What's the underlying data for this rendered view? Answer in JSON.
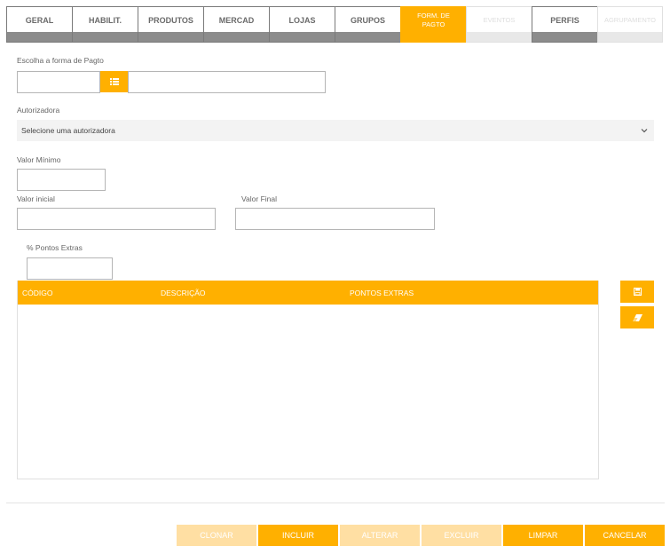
{
  "tabs": [
    {
      "label": "GERAL",
      "state": "normal"
    },
    {
      "label": "HABILIT.",
      "state": "normal"
    },
    {
      "label": "PRODUTOS",
      "state": "normal"
    },
    {
      "label": "MERCAD",
      "state": "normal"
    },
    {
      "label": "LOJAS",
      "state": "normal"
    },
    {
      "label": "GRUPOS",
      "state": "normal"
    },
    {
      "label": "FORM. DE PAGTO",
      "state": "active"
    },
    {
      "label": "EVENTOS",
      "state": "disabled"
    },
    {
      "label": "PERFIS",
      "state": "normal"
    },
    {
      "label": "AGRUPAMENTO",
      "state": "disabled"
    }
  ],
  "form": {
    "payment_label": "Escolha a forma de Pagto",
    "payment_code_value": "",
    "payment_desc_value": "",
    "authorizer_label": "Autorizadora",
    "authorizer_selected": "Selecione uma autorizadora",
    "min_value_label": "Valor Mínimo",
    "initial_value_label": "Valor inicial",
    "final_value_label": "Valor Final",
    "extra_points_label": "% Pontos Extras"
  },
  "grid": {
    "columns": [
      "CÓDIGO",
      "DESCRIÇÃO",
      "PONTOS EXTRAS"
    ],
    "rows": []
  },
  "actions": {
    "clone": "CLONAR",
    "include": "INCLUIR",
    "change": "ALTERAR",
    "delete": "EXCLUIR",
    "clear": "LIMPAR",
    "cancel": "CANCELAR"
  },
  "icons": {
    "list": "list-icon",
    "save": "save-icon",
    "eraser": "eraser-icon",
    "chevron": "chevron-down-icon"
  },
  "colors": {
    "accent": "#ffb000",
    "accent_disabled": "#ffdfa3",
    "tab_bar": "#8c8c8c"
  }
}
